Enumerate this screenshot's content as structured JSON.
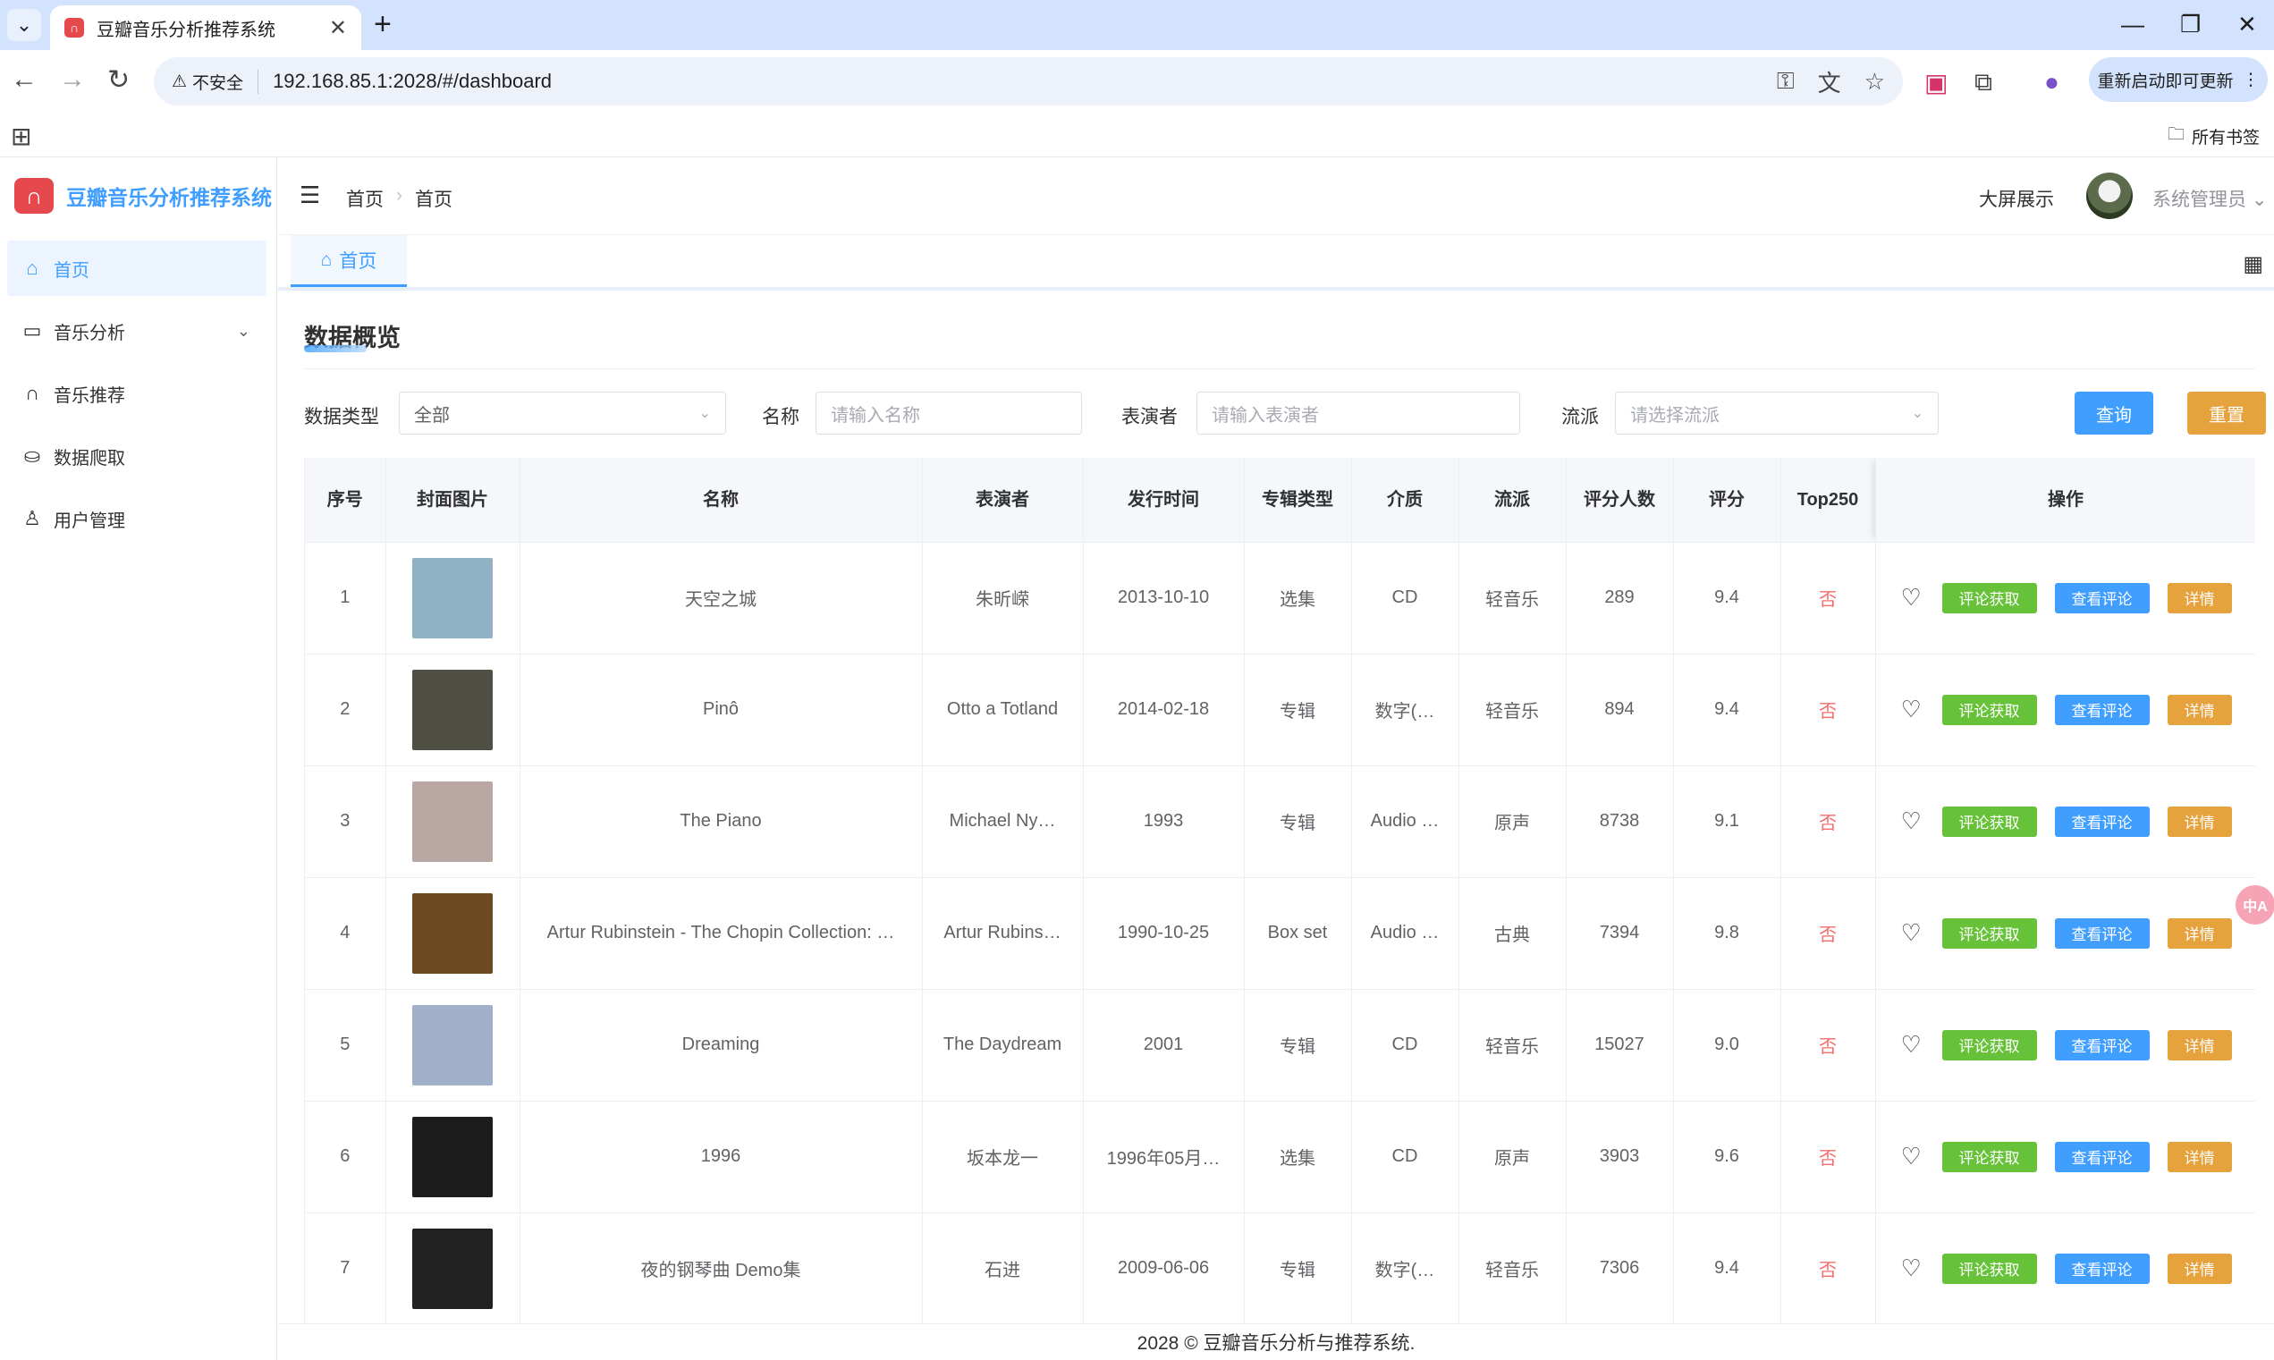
{
  "browser": {
    "tab_title": "豆瓣音乐分析推荐系统",
    "security_label": "不安全",
    "url": "192.168.85.1:2028/#/dashboard",
    "restart_label": "重新启动即可更新",
    "all_bookmarks": "所有书签"
  },
  "app": {
    "brand": "豆瓣音乐分析推荐系统",
    "menu": [
      {
        "label": "首页",
        "icon": "home-icon",
        "active": true
      },
      {
        "label": "音乐分析",
        "icon": "chart-icon",
        "expandable": true
      },
      {
        "label": "音乐推荐",
        "icon": "headphones-icon"
      },
      {
        "label": "数据爬取",
        "icon": "crawler-icon"
      },
      {
        "label": "用户管理",
        "icon": "user-icon"
      }
    ],
    "breadcrumb": [
      "首页",
      "首页"
    ],
    "bigscreen": "大屏展示",
    "username": "系统管理员",
    "active_tab": "首页"
  },
  "main": {
    "section_title": "数据概览",
    "filters": {
      "type_label": "数据类型",
      "type_value": "全部",
      "name_label": "名称",
      "name_placeholder": "请输入名称",
      "performer_label": "表演者",
      "performer_placeholder": "请输入表演者",
      "genre_label": "流派",
      "genre_placeholder": "请选择流派",
      "query_label": "查询",
      "reset_label": "重置"
    },
    "table": {
      "headers": [
        "序号",
        "封面图片",
        "名称",
        "表演者",
        "发行时间",
        "专辑类型",
        "介质",
        "流派",
        "评分人数",
        "评分",
        "Top250",
        "操作"
      ],
      "rows": [
        {
          "no": "1",
          "name": "天空之城",
          "performer": "朱昕嵘",
          "date": "2013-10-10",
          "type": "选集",
          "medium": "CD",
          "genre": "轻音乐",
          "count": "289",
          "score": "9.4",
          "top250": "否",
          "cover": "#8fb3c4"
        },
        {
          "no": "2",
          "name": "Pinô",
          "performer": "Otto a Totland",
          "date": "2014-02-18",
          "type": "专辑",
          "medium": "数字(…",
          "genre": "轻音乐",
          "count": "894",
          "score": "9.4",
          "top250": "否",
          "cover": "#4f4f44"
        },
        {
          "no": "3",
          "name": "The Piano",
          "performer": "Michael Ny…",
          "date": "1993",
          "type": "专辑",
          "medium": "Audio …",
          "genre": "原声",
          "count": "8738",
          "score": "9.1",
          "top250": "否",
          "cover": "#b9a7a4"
        },
        {
          "no": "4",
          "name": "Artur Rubinstein - The Chopin Collection: …",
          "performer": "Artur Rubins…",
          "date": "1990-10-25",
          "type": "Box set",
          "medium": "Audio …",
          "genre": "古典",
          "count": "7394",
          "score": "9.8",
          "top250": "否",
          "cover": "#6b4a1f"
        },
        {
          "no": "5",
          "name": "Dreaming",
          "performer": "The Daydream",
          "date": "2001",
          "type": "专辑",
          "medium": "CD",
          "genre": "轻音乐",
          "count": "15027",
          "score": "9.0",
          "top250": "否",
          "cover": "#9fb0c8"
        },
        {
          "no": "6",
          "name": "1996",
          "performer": "坂本龙一",
          "date": "1996年05月…",
          "type": "选集",
          "medium": "CD",
          "genre": "原声",
          "count": "3903",
          "score": "9.6",
          "top250": "否",
          "cover": "#1c1c1c"
        },
        {
          "no": "7",
          "name": "夜的钢琴曲 Demo集",
          "performer": "石进",
          "date": "2009-06-06",
          "type": "专辑",
          "medium": "数字(…",
          "genre": "轻音乐",
          "count": "7306",
          "score": "9.4",
          "top250": "否",
          "cover": "#222222"
        }
      ],
      "actions": {
        "fetch": "评论获取",
        "view": "查看评论",
        "detail": "详情"
      }
    },
    "footer": "2028 © 豆瓣音乐分析与推荐系统."
  }
}
